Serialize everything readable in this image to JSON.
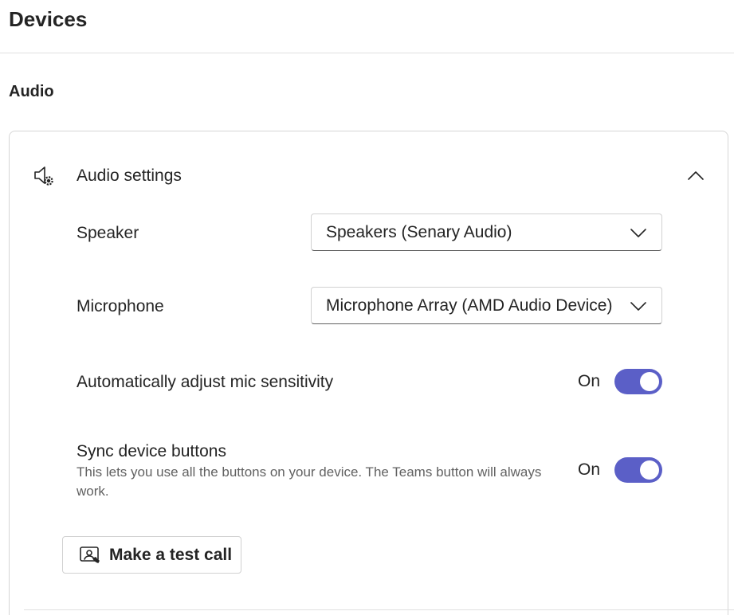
{
  "page": {
    "title": "Devices"
  },
  "section": {
    "title": "Audio"
  },
  "audio_settings": {
    "header_icon": "speaker-settings-icon",
    "header_label": "Audio settings",
    "collapse_icon": "chevron-up-icon",
    "speaker": {
      "label": "Speaker",
      "selected": "Speakers (Senary Audio)"
    },
    "microphone": {
      "label": "Microphone",
      "selected": "Microphone Array (AMD Audio Device)"
    },
    "auto_adjust": {
      "label": "Automatically adjust mic sensitivity",
      "state_text": "On",
      "enabled": true
    },
    "sync_buttons": {
      "label": "Sync device buttons",
      "description": "This lets you use all the buttons on your device. The Teams button will always work.",
      "state_text": "On",
      "enabled": true
    },
    "test_call": {
      "label": "Make a test call",
      "icon": "test-call-icon"
    }
  },
  "colors": {
    "accent": "#5b5fc7",
    "text": "#242424",
    "secondary_text": "#616161"
  }
}
